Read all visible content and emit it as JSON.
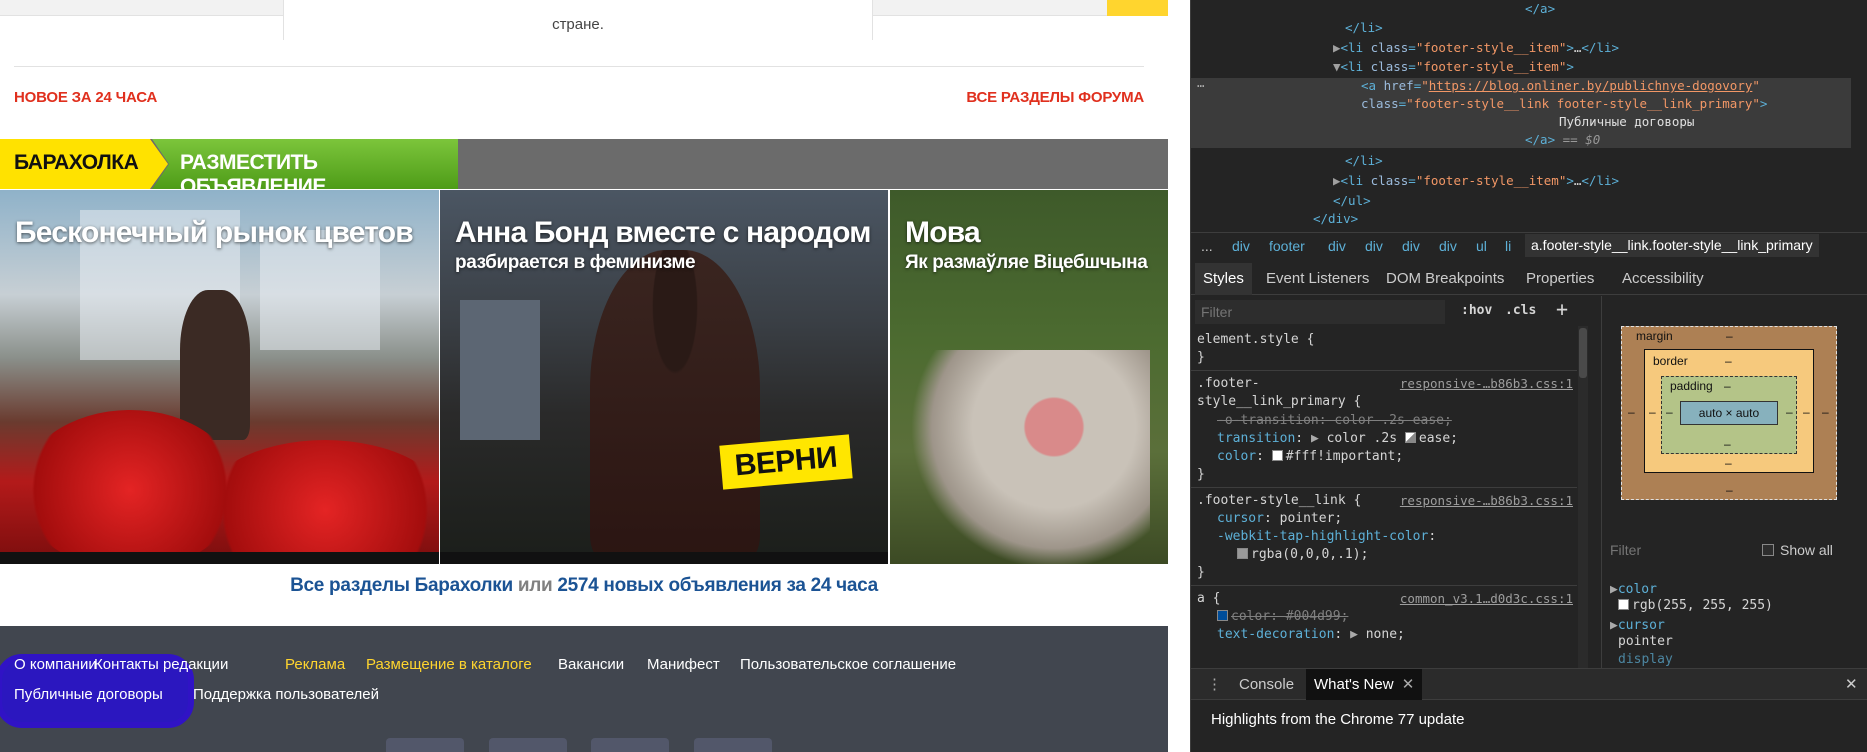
{
  "page": {
    "top_card_text": "стране.",
    "forum": {
      "new_label": "НОВОЕ ЗА 24 ЧАСА",
      "all_label": "ВСЕ РАЗДЕЛЫ ФОРУМА"
    },
    "baraholka": {
      "title": "БАРАХОЛКА",
      "post_ad": "РАЗМЕСТИТЬ ОБЪЯВЛЕНИЕ"
    },
    "tiles": [
      {
        "title": "Бесконечный рынок цветов",
        "subtitle": ""
      },
      {
        "title": "Анна Бонд вместе с народом",
        "subtitle": "разбирается в феминизме",
        "sign": "ВЕРНИ"
      },
      {
        "title": "Мова",
        "subtitle": "Як размаўляе Віцебшчына"
      }
    ],
    "caption": {
      "all_sections": "Все разделы Барахолки",
      "or": "или",
      "new_ads": "2574 новых объявления за 24 часа"
    },
    "footer": {
      "row1": [
        "О компании",
        "Контакты редакции",
        "Реклама",
        "Размещение в каталоге",
        "Вакансии",
        "Манифест",
        "Пользовательское соглашение"
      ],
      "row2": [
        "Публичные договоры",
        "Поддержка пользователей"
      ]
    }
  },
  "devtools": {
    "elements": {
      "close_a": "</a>",
      "close_li": "</li>",
      "li_collapsed": "footer-style__item",
      "li_open": "footer-style__item",
      "a_href": "https://blog.onliner.by/publichnye-dogovory",
      "a_class": "footer-style__link footer-style__link_primary",
      "a_text": "Публичные договоры",
      "a_eq": "== $0",
      "close_ul": "</ul>",
      "close_div": "</div>",
      "ellipsis": "…"
    },
    "breadcrumbs": [
      "...",
      "div",
      "footer",
      "div",
      "div",
      "div",
      "div",
      "ul",
      "li",
      "a.footer-style__link.footer-style__link_primary"
    ],
    "tabs": [
      "Styles",
      "Event Listeners",
      "DOM Breakpoints",
      "Properties",
      "Accessibility"
    ],
    "styles": {
      "filter_placeholder": "Filter",
      "hov": ":hov",
      "cls": ".cls",
      "element_style": "element.style {",
      "close_brace": "}",
      "rule1_selector_a": ".footer-",
      "rule1_selector_b": "style__link_primary {",
      "rule1_src": "responsive-…b86b3.css:1",
      "rule1_p1": "-o-transition: color .2s ease;",
      "rule1_p2_name": "transition",
      "rule1_p2_val": "color .2s",
      "rule1_p2_ease": "ease;",
      "rule1_p3_name": "color",
      "rule1_p3_val": "#fff!important;",
      "rule2_selector": ".footer-style__link {",
      "rule2_src": "responsive-…b86b3.css:1",
      "rule2_p1_name": "cursor",
      "rule2_p1_val": "pointer;",
      "rule2_p2_name": "-webkit-tap-highlight-color",
      "rule2_p2_val": "rgba(0,0,0,.1);",
      "rule3_selector": "a {",
      "rule3_src": "common_v3.1…d0d3c.css:1",
      "rule3_p1": "color: #004d99;",
      "rule3_p2_name": "text-decoration",
      "rule3_p2_val": "none;"
    },
    "boxmodel": {
      "margin": "margin",
      "border": "border",
      "padding": "padding",
      "content": "auto × auto",
      "dash": "–"
    },
    "computed": {
      "filter_placeholder": "Filter",
      "show_all": "Show all",
      "prop1": "color",
      "val1": "rgb(255, 255, 255)",
      "prop2": "cursor",
      "val2": "pointer",
      "prop3": "display"
    },
    "drawer": {
      "tabs": [
        "Console",
        "What's New"
      ],
      "highlights": "Highlights from the Chrome 77 update"
    }
  },
  "colors": {
    "accent_red": "#e0301e",
    "baraholka_yellow": "#ffe200",
    "post_green": "#5aa823",
    "footer_bg": "#41464f",
    "link_blue": "#1b5394",
    "annotation_blue": "#2f0fd0"
  },
  "icons": [
    "expand-triangle-icon",
    "collapse-triangle-icon",
    "plus-icon",
    "more-dots-icon",
    "close-icon",
    "close-tab-icon",
    "color-swatch-icon",
    "bezier-icon"
  ]
}
